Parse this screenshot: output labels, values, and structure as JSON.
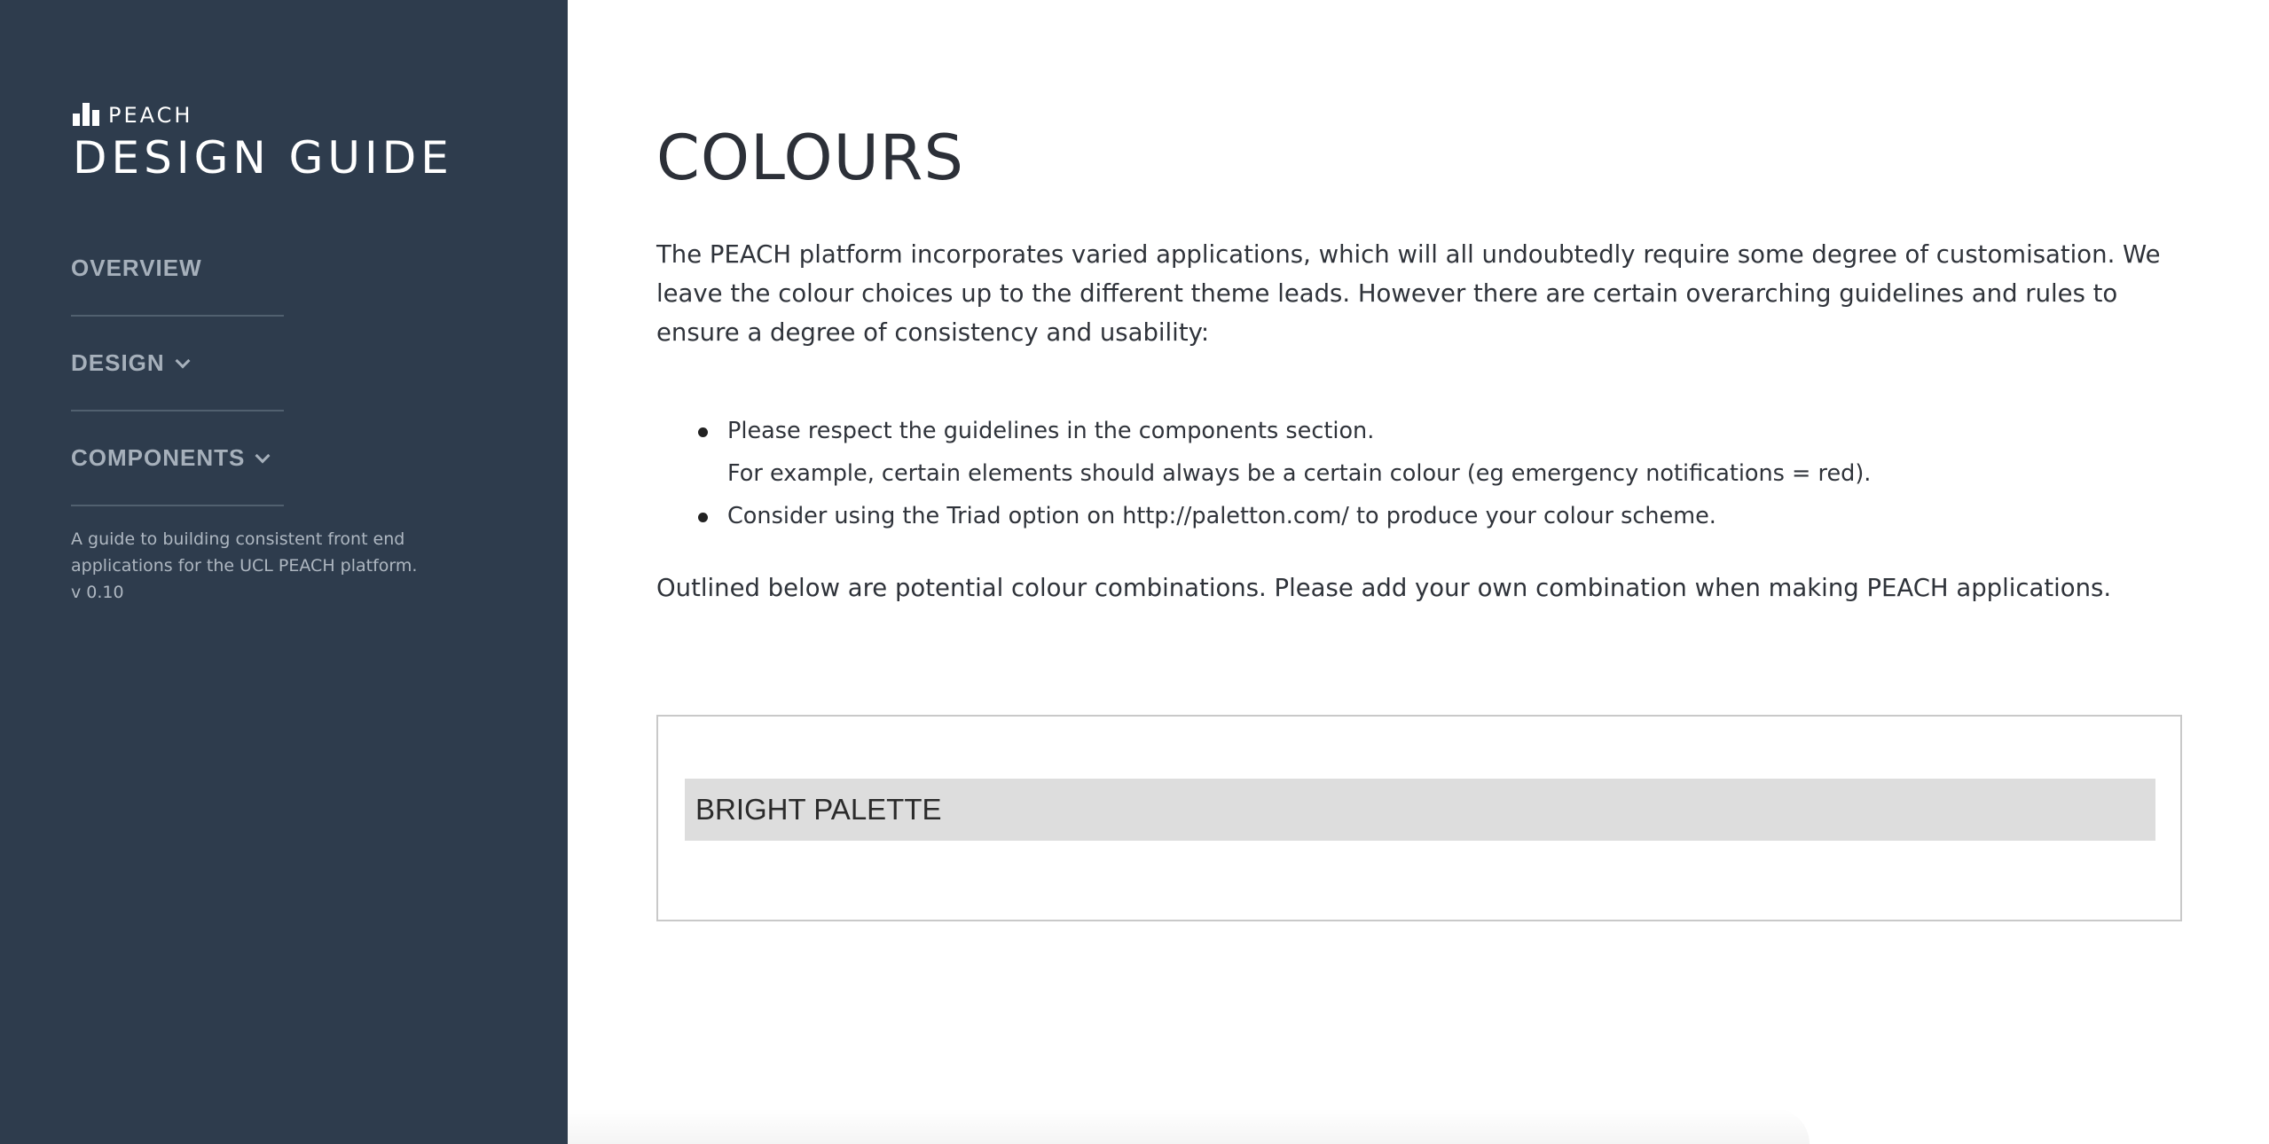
{
  "sidebar": {
    "brand_small": "PEACH",
    "brand_title": "DESIGN GUIDE",
    "logo_icon": "bar-chart-logo-icon",
    "nav": [
      {
        "label": "OVERVIEW",
        "has_chevron": false
      },
      {
        "label": "DESIGN",
        "has_chevron": true
      },
      {
        "label": "COMPONENTS",
        "has_chevron": true
      }
    ],
    "description_line1": "A guide to building consistent front end",
    "description_line2": "applications for the UCL PEACH platform.",
    "version": "v 0.10",
    "background_color": "#2e3c4d"
  },
  "main": {
    "title": "COLOURS",
    "intro": "The PEACH platform incorporates varied applications, which will all undoubtedly require some degree of customisation. We leave the colour choices up to the different theme leads. However there are certain overarching guidelines and rules to ensure a degree of consistency and usability:",
    "guidelines": [
      {
        "text": "Please respect the guidelines in the components section.",
        "subtext": "For example, certain elements should always be a certain colour (eg emergency notifications = red)."
      },
      {
        "text": "Consider using the Triad option on http://paletton.com/ to produce your colour scheme."
      }
    ],
    "outline": "Outlined below are potential colour combinations. Please add your own combination when making PEACH applications.",
    "palette": {
      "title": "BRIGHT PALETTE",
      "header_color": "#dddddd"
    }
  }
}
